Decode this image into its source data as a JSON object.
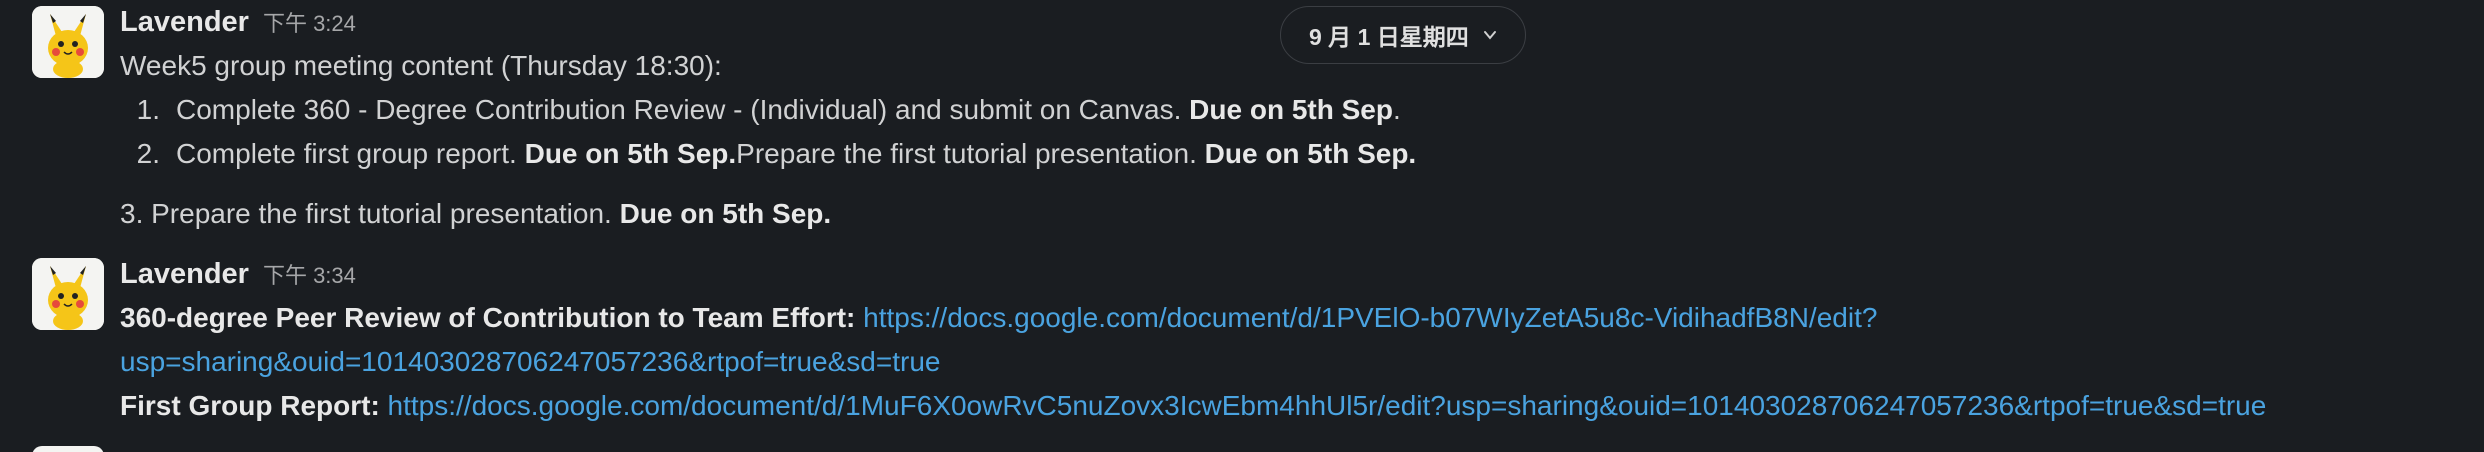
{
  "date_divider": {
    "label": "9 月 1 日星期四"
  },
  "messages": [
    {
      "author": "Lavender",
      "time": "下午 3:24",
      "avatar_icon": "pikachu-avatar-icon",
      "intro": "Week5 group meeting content (Thursday 18:30):",
      "list": [
        {
          "num": "1.",
          "text": "Complete 360 - Degree Contribution Review - (Individual) and submit on Canvas. ",
          "bold": "Due on 5th Sep",
          "tail": "."
        },
        {
          "num": "2.",
          "text": "Complete first group report. ",
          "bold": "Due on 5th Sep.",
          "text2": "Prepare the first tutorial presentation. ",
          "bold2": "Due on 5th Sep."
        }
      ],
      "after": {
        "text": "3. Prepare the first tutorial presentation. ",
        "bold": "Due on 5th Sep."
      }
    },
    {
      "author": "Lavender",
      "time": "下午 3:34",
      "avatar_icon": "pikachu-avatar-icon",
      "peer_review": {
        "label": "360-degree Peer Review of Contribution to Team Effort:",
        "link_line1": "https://docs.google.com/document/d/1PVElO-b07WIyZetA5u8c-VidihadfB8N/edit?",
        "link_line2": "usp=sharing&ouid=101403028706247057236&rtpof=true&sd=true"
      },
      "group_report": {
        "label": "First Group Report:",
        "link": "https://docs.google.com/document/d/1MuF6X0owRvC5nuZovx3IcwEbm4hhUl5r/edit?usp=sharing&ouid=101403028706247057236&rtpof=true&sd=true"
      }
    }
  ],
  "colors": {
    "background": "#1a1d21",
    "text": "#d1d2d3",
    "link": "#4aa3e0",
    "timestamp": "#a6a7a9"
  }
}
